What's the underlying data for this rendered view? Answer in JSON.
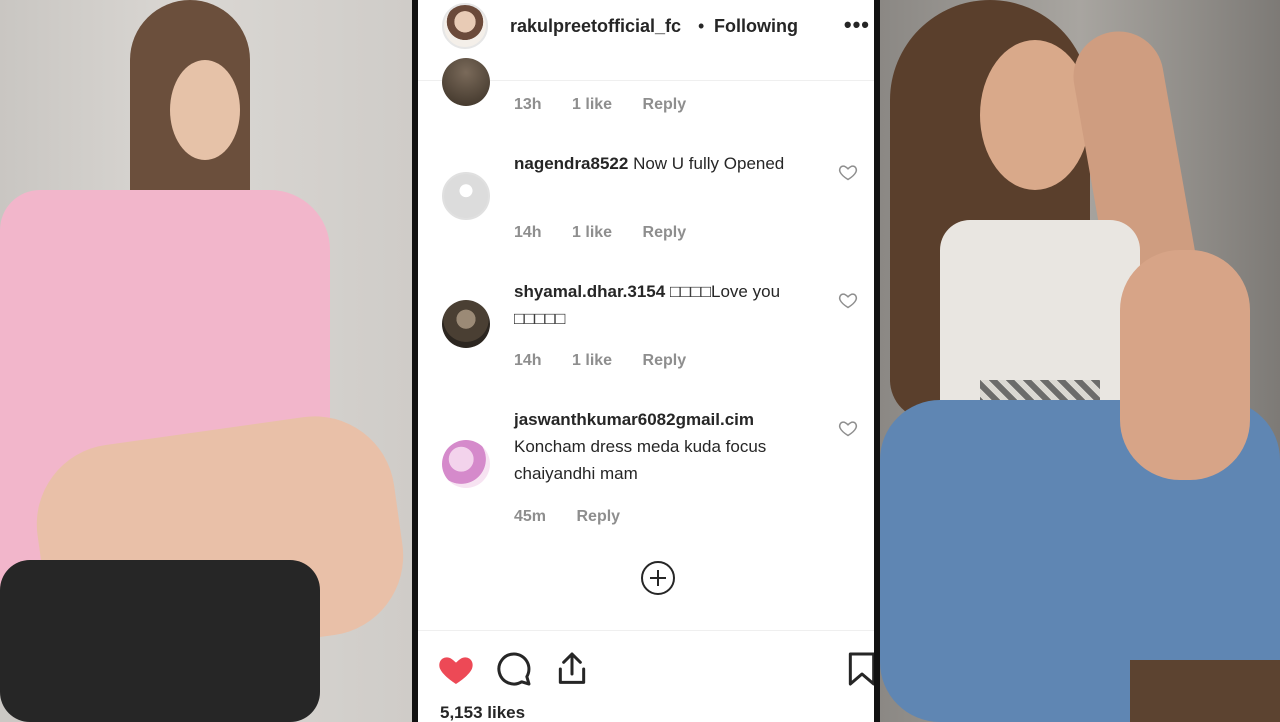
{
  "post": {
    "username": "rakulpreetofficial_fc",
    "separator": "•",
    "follow_status": "Following",
    "more_icon": "more-options-icon",
    "likes": "5,153 likes"
  },
  "comments": [
    {
      "user": "",
      "text": "",
      "time": "13h",
      "likes": "1 like",
      "reply": "Reply"
    },
    {
      "user": "nagendra8522",
      "text": "Now U fully Opened",
      "time": "14h",
      "likes": "1 like",
      "reply": "Reply"
    },
    {
      "user": "shyamal.dhar.3154",
      "text": "□□□□Love you □□□□□",
      "time": "14h",
      "likes": "1 like",
      "reply": "Reply"
    },
    {
      "user": "jaswanthkumar6082gmail.cim",
      "text": "Koncham dress meda kuda focus chaiyandhi mam",
      "time": "45m",
      "likes": "",
      "reply": "Reply"
    }
  ],
  "actions": {
    "like_icon": "heart-filled-icon",
    "comment_icon": "comment-icon",
    "share_icon": "share-icon",
    "save_icon": "bookmark-icon",
    "add_comment_icon": "plus-circle-icon",
    "like_color": "#ed4956"
  }
}
